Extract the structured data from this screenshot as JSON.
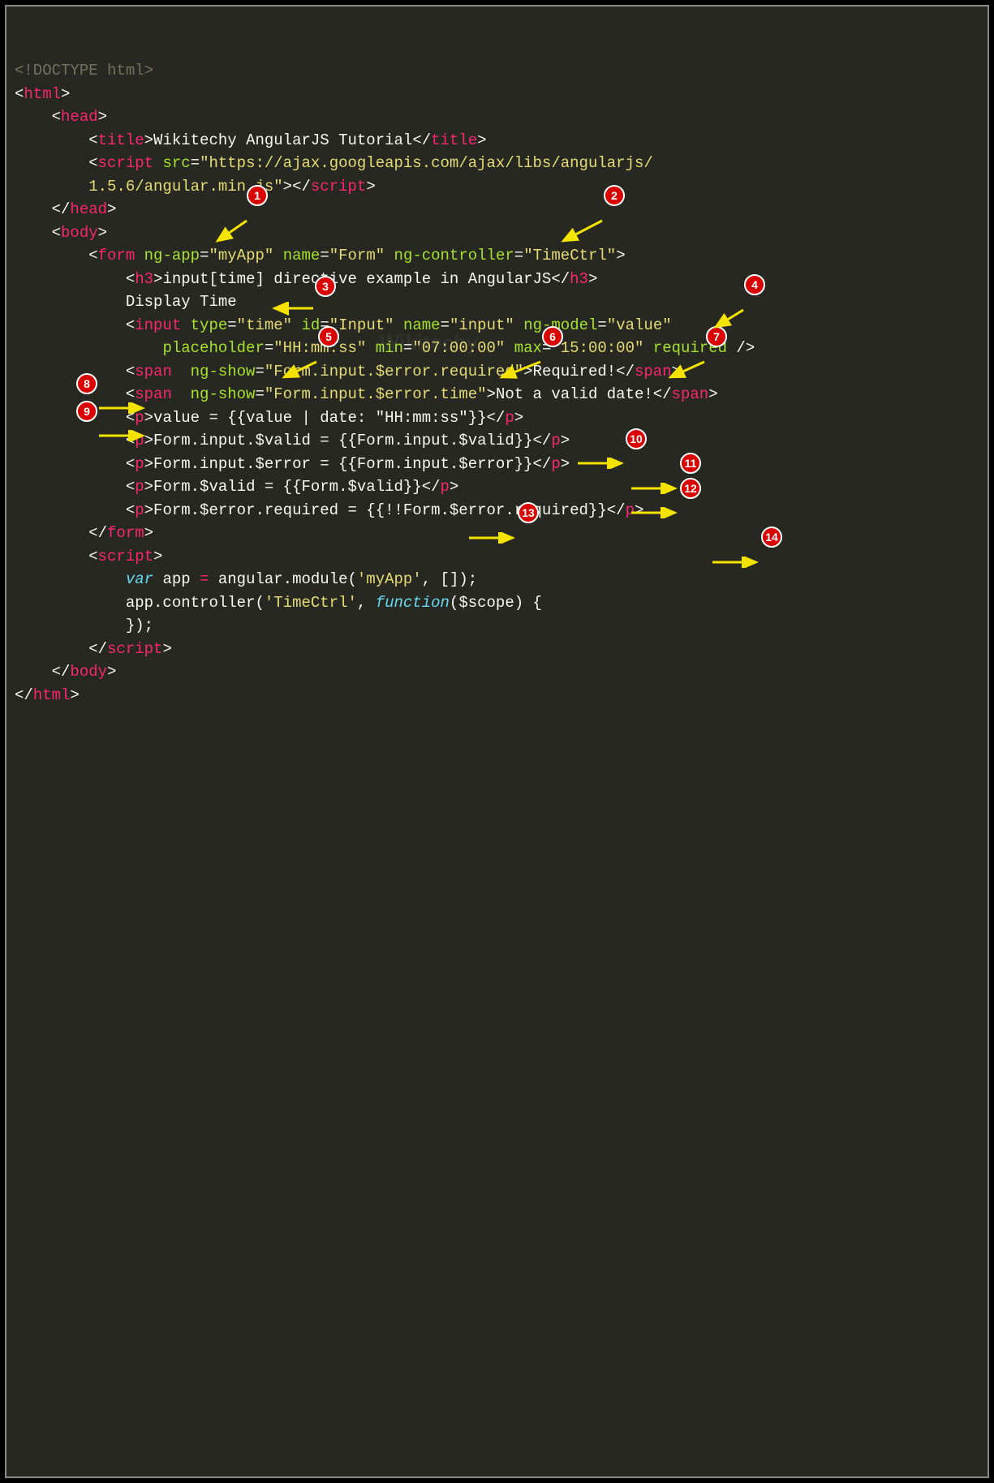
{
  "code": {
    "l1": "<!DOCTYPE html>",
    "l2a": "<",
    "l2b": "html",
    "l2c": ">",
    "l3a": "<",
    "l3b": "head",
    "l3c": ">",
    "l4a": "<",
    "l4b": "title",
    "l4c": ">",
    "l4d": "Wikitechy AngularJS Tutorial",
    "l4e": "</",
    "l4f": "title",
    "l4g": ">",
    "l5a": "<",
    "l5b": "script",
    "l5c": " src",
    "l5d": "=",
    "l5e": "\"https://ajax.googleapis.com/ajax/libs/angularjs/",
    "l6a": "1.5.6/angular.min.js\"",
    "l6b": "></",
    "l6c": "script",
    "l6d": ">",
    "l7a": "</",
    "l7b": "head",
    "l7c": ">",
    "l8a": "<",
    "l8b": "body",
    "l8c": ">",
    "l9a": "<",
    "l9b": "form",
    "l9c": " ng-app",
    "l9d": "=",
    "l9e": "\"myApp\"",
    "l9f": " name",
    "l9g": "=",
    "l9h": "\"Form\"",
    "l9i": " ng-controller",
    "l9j": "=",
    "l9k": "\"TimeCtrl\"",
    "l9l": ">",
    "l10a": "<",
    "l10b": "h3",
    "l10c": ">",
    "l10d": "input[time] directive example in AngularJS",
    "l10e": "</",
    "l10f": "h3",
    "l10g": ">",
    "l11": "Display Time",
    "l12a": "<",
    "l12b": "input",
    "l12c": " type",
    "l12d": "=",
    "l12e": "\"time\"",
    "l12f": " id",
    "l12g": "=",
    "l12h": "\"Input\"",
    "l12i": " name",
    "l12j": "=",
    "l12k": "\"input\"",
    "l12l": " ng-model",
    "l12m": "=",
    "l12n": "\"value\"",
    "l13a": "placeholder",
    "l13b": "=",
    "l13c": "\"HH:mm:ss\"",
    "l13d": " min",
    "l13e": "=",
    "l13f": "\"07:00:00\"",
    "l13g": " max",
    "l13h": "=",
    "l13i": "\"15:00:00\"",
    "l13j": " required",
    "l13k": " />",
    "l14a": "<",
    "l14b": "span",
    "l14c": "  ng-show",
    "l14d": "=",
    "l14e": "\"Form.input.$error.required\"",
    "l14f": ">",
    "l14g": "Required!",
    "l14h": "</",
    "l14i": "span",
    "l14j": ">",
    "l15a": "<",
    "l15b": "span",
    "l15c": "  ng-show",
    "l15d": "=",
    "l15e": "\"Form.input.$error.time\"",
    "l15f": ">",
    "l15g": "Not a valid date!",
    "l15h": "</",
    "l15i": "span",
    "l15j": ">",
    "l16a": "<",
    "l16b": "p",
    "l16c": ">",
    "l16d": "value = {{value | date: \"HH:mm:ss\"}}",
    "l16e": "</",
    "l16f": "p",
    "l16g": ">",
    "l17a": "<",
    "l17b": "p",
    "l17c": ">",
    "l17d": "Form.input.$valid = {{Form.input.$valid}}",
    "l17e": "</",
    "l17f": "p",
    "l17g": ">",
    "l18a": "<",
    "l18b": "p",
    "l18c": ">",
    "l18d": "Form.input.$error = {{Form.input.$error}}",
    "l18e": "</",
    "l18f": "p",
    "l18g": ">",
    "l19a": "<",
    "l19b": "p",
    "l19c": ">",
    "l19d": "Form.$valid = {{Form.$valid}}",
    "l19e": "</",
    "l19f": "p",
    "l19g": ">",
    "l20a": "<",
    "l20b": "p",
    "l20c": ">",
    "l20d": "Form.$error.required = {{!!Form.$error.required}}",
    "l20e": "</",
    "l20f": "p",
    "l20g": ">",
    "l21a": "</",
    "l21b": "form",
    "l21c": ">",
    "l22a": "<",
    "l22b": "script",
    "l22c": ">",
    "l23a": "var",
    "l23b": " app ",
    "l23c": "=",
    "l23d": " angular.module(",
    "l23e": "'myApp'",
    "l23f": ", []);",
    "l24a": "app.controller(",
    "l24b": "'TimeCtrl'",
    "l24c": ", ",
    "l24d": "function",
    "l24e": "($scope) {",
    "l25": "});",
    "l26a": "</",
    "l26b": "script",
    "l26c": ">",
    "l27a": "</",
    "l27b": "body",
    "l27c": ">",
    "l28a": "</",
    "l28b": "html",
    "l28c": ">"
  },
  "badges": [
    "1",
    "2",
    "3",
    "4",
    "5",
    "6",
    "7",
    "8",
    "9",
    "10",
    "11",
    "12",
    "13",
    "14"
  ],
  "watermark": "Wikitechy"
}
